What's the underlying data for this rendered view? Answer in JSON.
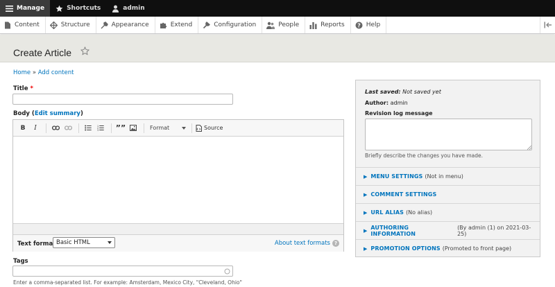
{
  "toolbar": {
    "manage": "Manage",
    "shortcuts": "Shortcuts",
    "user": "admin"
  },
  "menu": {
    "items": [
      "Content",
      "Structure",
      "Appearance",
      "Extend",
      "Configuration",
      "People",
      "Reports",
      "Help"
    ]
  },
  "page": {
    "title": "Create Article"
  },
  "breadcrumb": {
    "home": "Home",
    "separator": "»",
    "current": "Add content"
  },
  "form": {
    "title_label": "Title",
    "required_mark": "*",
    "title_value": "",
    "body_label": "Body",
    "edit_summary_prefix": "(",
    "edit_summary": "Edit summary",
    "edit_summary_suffix": ")",
    "editor": {
      "bold": "B",
      "italic": "I",
      "blockquote": "””",
      "format_select": "Format",
      "source": "Source"
    },
    "text_format_label": "Text format",
    "text_format_value": "Basic HTML",
    "about_text_formats": "About text formats",
    "help_glyph": "?",
    "tags_label": "Tags",
    "tags_value": "",
    "tags_help": "Enter a comma-separated list. For example: Amsterdam, Mexico City, \"Cleveland, Ohio\""
  },
  "sidebar": {
    "last_saved_label": "Last saved:",
    "last_saved_value": "Not saved yet",
    "author_label": "Author:",
    "author_value": "admin",
    "revision_label": "Revision log message",
    "revision_value": "",
    "revision_help": "Briefly describe the changes you have made.",
    "sections": [
      {
        "title": "MENU SETTINGS",
        "summary": "(Not in menu)"
      },
      {
        "title": "COMMENT SETTINGS",
        "summary": ""
      },
      {
        "title": "URL ALIAS",
        "summary": "(No alias)"
      },
      {
        "title": "AUTHORING INFORMATION",
        "summary": "(By admin (1) on 2021-03-25)"
      },
      {
        "title": "PROMOTION OPTIONS",
        "summary": "(Promoted to front page)"
      }
    ]
  },
  "colors": {
    "link": "#0074bd",
    "toolbar_bg": "#0f0f0f",
    "header_bg": "#e8e8e3"
  }
}
